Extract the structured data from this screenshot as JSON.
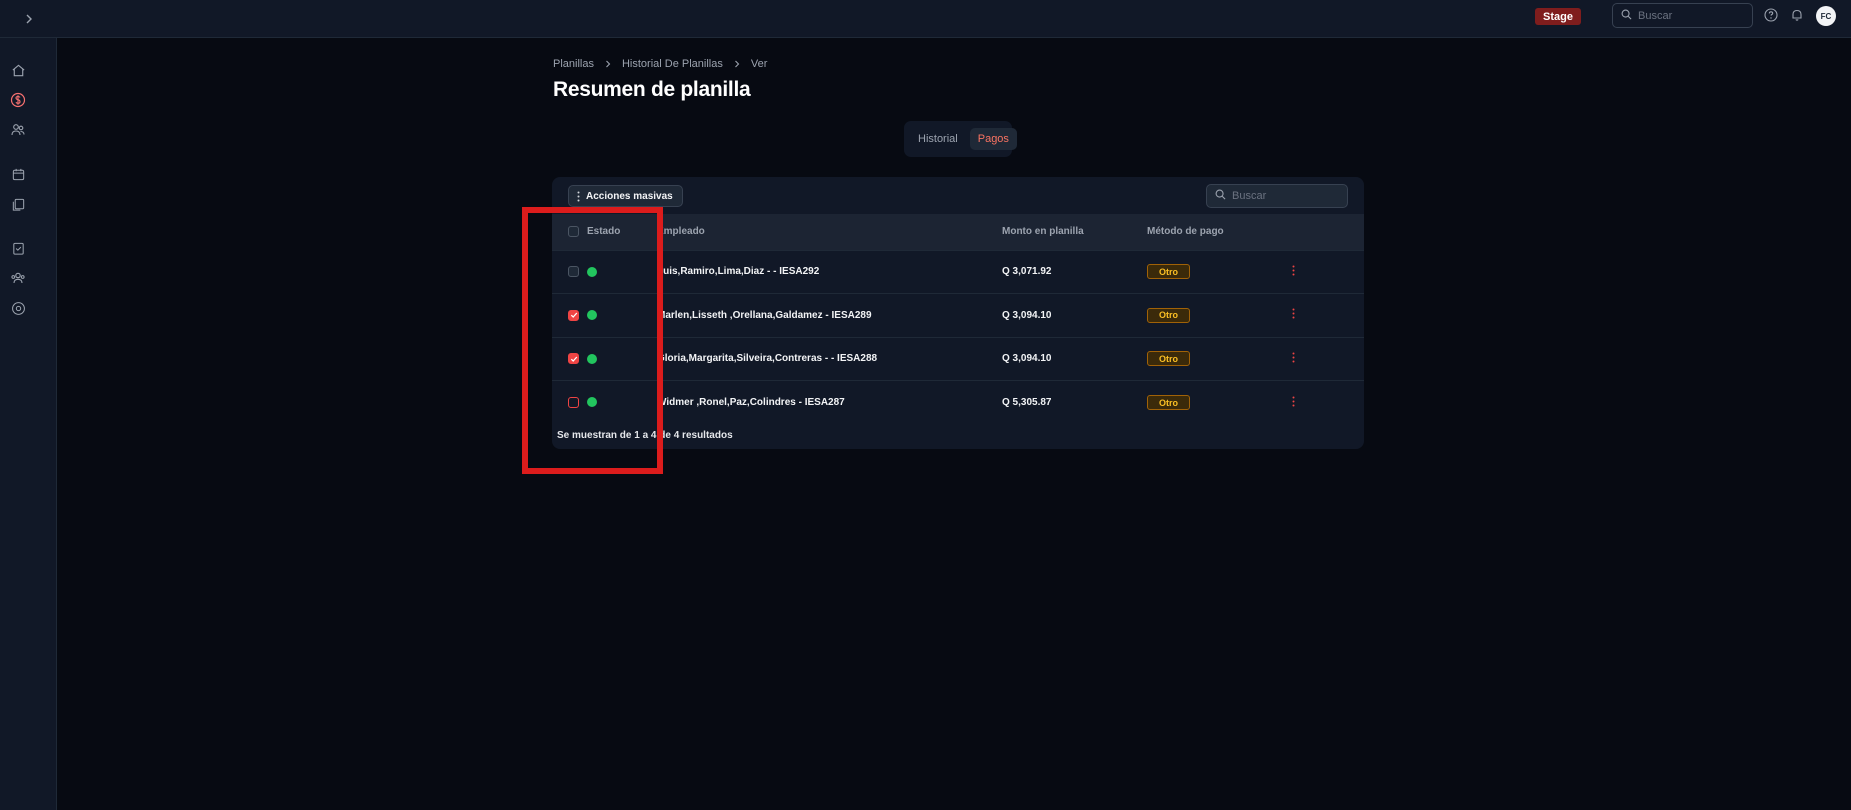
{
  "topbar": {
    "stage_label": "Stage",
    "search_placeholder": "Buscar",
    "avatar_initials": "FC"
  },
  "sidebar": {
    "items": [
      {
        "icon": "home-icon"
      },
      {
        "icon": "dollar-circle-icon",
        "active": true
      },
      {
        "icon": "users-icon"
      },
      {
        "icon": "calendar-icon"
      },
      {
        "icon": "documents-icon"
      },
      {
        "icon": "clipboard-icon"
      },
      {
        "icon": "team-icon"
      },
      {
        "icon": "settings-circle-icon"
      }
    ]
  },
  "breadcrumb": {
    "items": [
      "Planillas",
      "Historial De Planillas",
      "Ver"
    ]
  },
  "page": {
    "title": "Resumen de planilla"
  },
  "tabs": [
    {
      "label": "Historial",
      "active": false
    },
    {
      "label": "Pagos",
      "active": true
    }
  ],
  "table": {
    "bulk_actions_label": "Acciones masivas",
    "search_placeholder": "Buscar",
    "columns": [
      "Estado",
      "Empleado",
      "Monto en planilla",
      "Método de pago"
    ],
    "rows": [
      {
        "checked": false,
        "status_color": "#22c55e",
        "employee": "Luis,Ramiro,Lima,Diaz - - IESA292",
        "amount": "Q 3,071.92",
        "payment_method": "Otro"
      },
      {
        "checked": true,
        "status_color": "#22c55e",
        "employee": "Marlen,Lisseth ,Orellana,Galdamez - IESA289",
        "amount": "Q 3,094.10",
        "payment_method": "Otro"
      },
      {
        "checked": true,
        "status_color": "#22c55e",
        "employee": "Gloria,Margarita,Silveira,Contreras - - IESA288",
        "amount": "Q 3,094.10",
        "payment_method": "Otro"
      },
      {
        "checked": false,
        "status_color": "#22c55e",
        "employee": "Widmer ,Ronel,Paz,Colindres - IESA287",
        "amount": "Q 5,305.87",
        "payment_method": "Otro"
      }
    ],
    "footer": "Se muestran de 1 a 4 de 4 resultados"
  },
  "colors": {
    "accent": "#ef4444",
    "highlight": "#dc1c1c",
    "status_ok": "#22c55e",
    "badge": "#fbbf24"
  }
}
